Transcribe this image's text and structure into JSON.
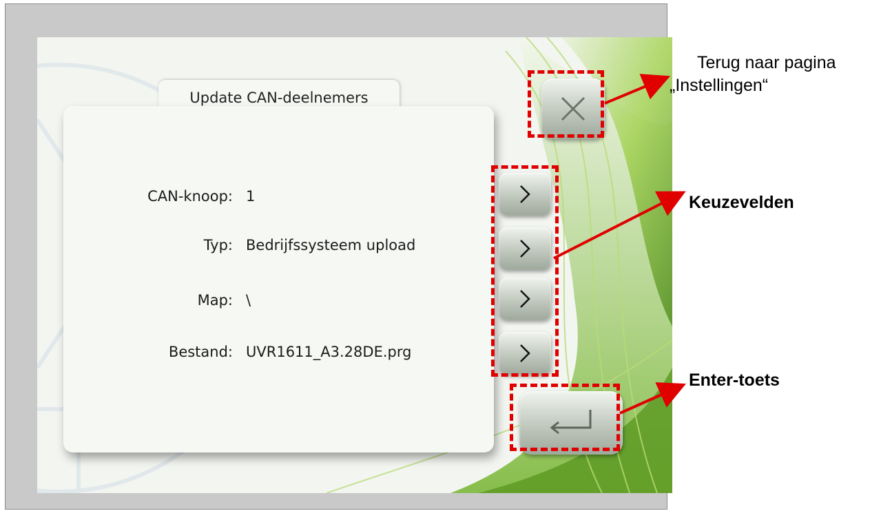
{
  "dialog": {
    "title": "Update CAN-deelnemers",
    "fields": [
      {
        "label": "CAN-knoop:",
        "value": "1"
      },
      {
        "label": "Typ:",
        "value": "Bedrijfssysteem upload"
      },
      {
        "label": "Map:",
        "value": "\\"
      },
      {
        "label": "Bestand:",
        "value": "UVR1611_A3.28DE.prg"
      }
    ]
  },
  "buttons": {
    "close_icon": "close-icon",
    "select_icon": "chevron-right-icon",
    "enter_icon": "enter-arrow-icon"
  },
  "annotations": {
    "back_line1": "Terug naar pagina",
    "back_line2": "„Instellingen“",
    "select_fields": "Keuzevelden",
    "enter_key": "Enter-toets"
  },
  "colors": {
    "dashed_box": "#e00000",
    "arrow": "#e00000",
    "accent_green": "#8cc43c"
  }
}
